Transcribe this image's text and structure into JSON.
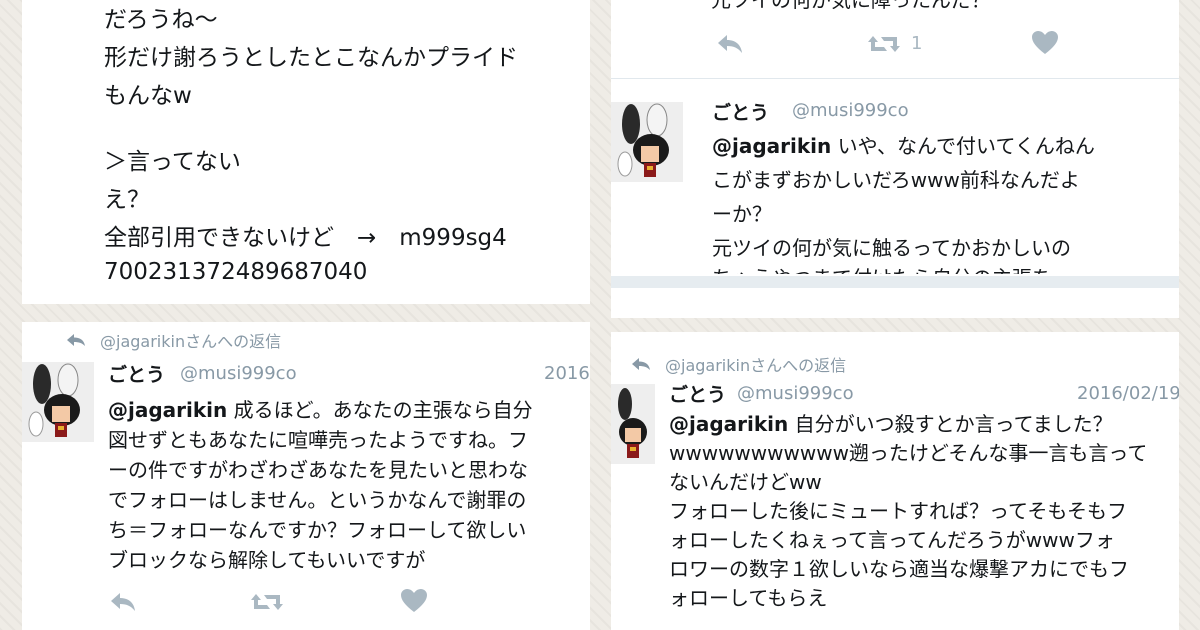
{
  "panel1": {
    "lines": [
      "だろうね〜",
      "形だけ謝ろうとしたとこなんかプライド",
      "もんなw",
      "",
      "＞言ってない",
      "え？",
      "全部引用できないけど　→　m999sg4",
      "700231372489687040"
    ]
  },
  "panel2": {
    "top_line": "元ツイの何が気に障ったんだ？",
    "retweet_count": "1",
    "tweet": {
      "name": "ごとう",
      "handle": "@musi999co",
      "mention": "@jagarikin",
      "lines": [
        "いや、なんで付いてくんねん",
        "こがまずおかしいだろwww前科なんだよ",
        "ーか？",
        "元ツイの何が気に触るってかおかしいの",
        "ちゃうやつまで付けたら自分の主張を"
      ]
    }
  },
  "panel3": {
    "reply_to": "@jagarikinさんへの返信",
    "name": "ごとう",
    "handle": "@musi999co",
    "date": "2016",
    "mention": "@jagarikin",
    "lines": [
      "成るほど。あなたの主張なら自分",
      "図せずともあなたに喧嘩売ったようですね。フ",
      "ーの件ですがわざわざあなたを見たいと思わな",
      "でフォローはしません。というかなんで謝罪の",
      "ち＝フォローなんですか？フォローして欲しい",
      "ブロックなら解除してもいいですが"
    ]
  },
  "panel4": {
    "reply_to": "@jagarikinさんへの返信",
    "name": "ごとう",
    "handle": "@musi999co",
    "date": "2016/02/19",
    "mention": "@jagarikin",
    "lines": [
      "自分がいつ殺すとか言ってました？",
      "wwwwwwwwwww遡ったけどそんな事一言も言って",
      "ないんだけどww",
      "フォローした後にミュートすれば？ってそもそもフ",
      "ォローしたくねぇって言ってんだろうがwwwフォ",
      "ロワーの数字１欲しいなら適当な爆撃アカにでもフ",
      "ォローしてもらえ"
    ]
  },
  "icons": {
    "reply": "reply-icon",
    "retweet": "retweet-icon",
    "like": "heart-icon",
    "reply_arrow": "reply-arrow-icon"
  },
  "colors": {
    "muted": "#8899a6",
    "action": "#aab8c2",
    "text": "#14171a"
  }
}
